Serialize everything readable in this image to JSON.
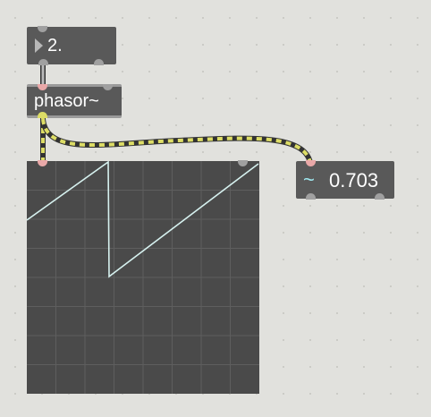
{
  "patcher": {
    "number_box": {
      "value": "2."
    },
    "phasor_object": {
      "label": "phasor~"
    },
    "number_tilde": {
      "symbol": "~",
      "value": "0.703"
    },
    "scope": {
      "waveform": "sawtooth"
    },
    "colors": {
      "background": "#e1e1dd",
      "object_fill": "#595959",
      "signal_cable": "#dddd66",
      "scope_trace": "#d6f1ef",
      "number_tilde_icon": "#9fe8f0"
    }
  }
}
